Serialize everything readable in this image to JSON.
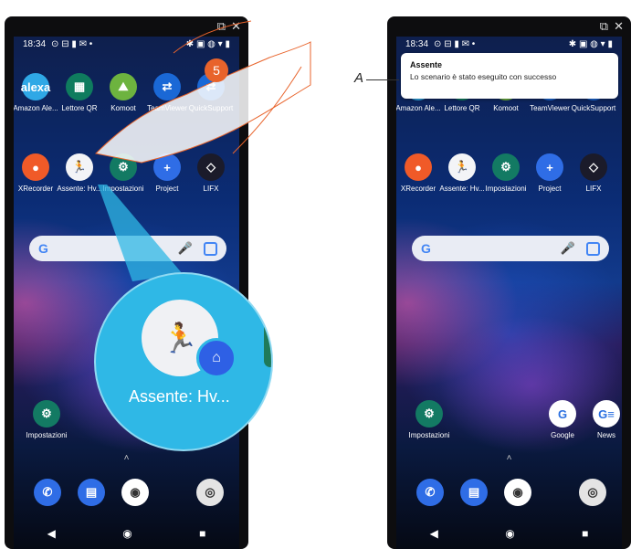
{
  "statusbar": {
    "time": "18:34",
    "left_icons": "⊙ ⊟ ▮ ✉ •",
    "right_icons": "✱ ▣ ◍ ▾ ▮"
  },
  "window_icons": {
    "popout": "⧉",
    "close": "✕"
  },
  "left": {
    "row1": [
      {
        "label": "Amazon Ale...",
        "glyph": "alexa",
        "color": "#2fa8e6",
        "icon": "alexa-icon"
      },
      {
        "label": "Lettore QR",
        "glyph": "▦",
        "color": "#0f7c5e",
        "icon": "qr-code-icon"
      },
      {
        "label": "Komoot",
        "glyph": "⛰",
        "color": "#6db33f",
        "icon": "komoot-icon"
      },
      {
        "label": "TeamViewer",
        "glyph": "⇄",
        "color": "#1a68d6",
        "icon": "teamviewer-icon"
      },
      {
        "label": "QuickSupport",
        "glyph": "⇄",
        "color": "#1a68d6",
        "icon": "quicksupport-icon"
      }
    ],
    "row2": [
      {
        "label": "XRecorder",
        "glyph": "●",
        "color": "#f05a28",
        "icon": "xrecorder-icon"
      },
      {
        "label": "Assente: Hv...",
        "glyph": "🏃",
        "color": "#f3f4f7",
        "icon": "scenario-shortcut-icon"
      },
      {
        "label": "Impostazioni",
        "glyph": "⚙",
        "color": "#137a63",
        "icon": "settings-gear-icon"
      },
      {
        "label": "Project",
        "glyph": "+",
        "color": "#2f6de6",
        "icon": "project-plus-icon"
      },
      {
        "label": "LIFX",
        "glyph": "◇",
        "color": "#1b1b2a",
        "icon": "lifx-icon"
      }
    ],
    "bottom_app": {
      "label": "Impostazioni",
      "glyph": "⚙",
      "color": "#137a63",
      "icon": "settings-gear-icon"
    },
    "step_number": "5",
    "zoom_label": "Assente: Hv..."
  },
  "right": {
    "row1": [
      {
        "label": "Amazon Ale...",
        "glyph": "alexa",
        "color": "#2fa8e6",
        "icon": "alexa-icon"
      },
      {
        "label": "Lettore QR",
        "glyph": "▦",
        "color": "#0f7c5e",
        "icon": "qr-code-icon"
      },
      {
        "label": "Komoot",
        "glyph": "⛰",
        "color": "#6db33f",
        "icon": "komoot-icon"
      },
      {
        "label": "TeamViewer",
        "glyph": "⇄",
        "color": "#1a68d6",
        "icon": "teamviewer-icon"
      },
      {
        "label": "QuickSupport",
        "glyph": "⇄",
        "color": "#1a68d6",
        "icon": "quicksupport-icon"
      }
    ],
    "row2": [
      {
        "label": "XRecorder",
        "glyph": "●",
        "color": "#f05a28",
        "icon": "xrecorder-icon"
      },
      {
        "label": "Assente: Hv...",
        "glyph": "🏃",
        "color": "#f3f4f7",
        "icon": "scenario-shortcut-icon"
      },
      {
        "label": "Impostazioni",
        "glyph": "⚙",
        "color": "#137a63",
        "icon": "settings-gear-icon"
      },
      {
        "label": "Project",
        "glyph": "+",
        "color": "#2f6de6",
        "icon": "project-plus-icon"
      },
      {
        "label": "LIFX",
        "glyph": "◇",
        "color": "#1b1b2a",
        "icon": "lifx-icon"
      }
    ],
    "bottom_apps": [
      {
        "label": "Impostazioni",
        "glyph": "⚙",
        "color": "#137a63",
        "icon": "settings-gear-icon"
      },
      {
        "label": "Google",
        "glyph": "G",
        "color": "#ffffff",
        "icon": "google-icon"
      },
      {
        "label": "News",
        "glyph": "G≡",
        "color": "#ffffff",
        "icon": "news-icon"
      }
    ],
    "notification": {
      "title": "Assente",
      "body": "Lo scenario è stato eseguito con successo"
    },
    "marker": "A"
  },
  "dock": [
    {
      "glyph": "✆",
      "color": "#2f6de6",
      "icon": "phone-icon"
    },
    {
      "glyph": "▤",
      "color": "#2f6de6",
      "icon": "messages-icon"
    },
    {
      "glyph": "◉",
      "color": "#ffffff",
      "icon": "chrome-icon"
    },
    {
      "glyph": "◎",
      "color": "#e4e4e4",
      "icon": "camera-icon"
    }
  ],
  "nav": {
    "back": "◀",
    "home": "◉",
    "recents": "■"
  },
  "caret": "˄"
}
